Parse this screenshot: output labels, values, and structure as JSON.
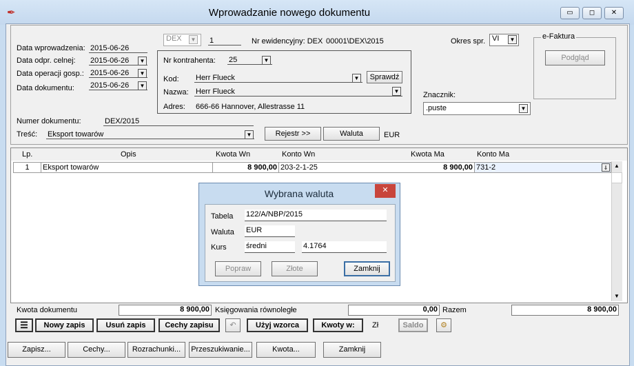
{
  "window": {
    "title": "Wprowadzanie nowego dokumentu",
    "minimize": "▭",
    "restore": "◻",
    "close": "✕"
  },
  "header": {
    "data_wprowadzenia_label": "Data wprowadzenia:",
    "data_wprowadzenia": "2015-06-26",
    "data_odpr_label": "Data odpr. celnej:",
    "data_odpr": "2015-06-26",
    "data_operacji_label": "Data operacji gosp.:",
    "data_operacji": "2015-06-26",
    "data_dokumentu_label": "Data dokumentu:",
    "data_dokumentu": "2015-06-26",
    "doc_type": "DEX",
    "doc_number": "1",
    "nr_ewid_label": "Nr ewidencyjny: DEX",
    "nr_ewid": "00001\\DEX\\2015",
    "okres_label": "Okres spr.",
    "okres": "VI",
    "nr_kontrahenta_label": "Nr kontrahenta:",
    "nr_kontrahenta": "25",
    "kod_label": "Kod:",
    "kod": "Herr Flueck",
    "sprawdz": "Sprawdź",
    "nazwa_label": "Nazwa:",
    "nazwa": "Herr Flueck",
    "adres_label": "Adres:",
    "adres": "666-66 Hannover, Allestrasse 11",
    "efaktura_label": "e-Faktura",
    "podglad": "Podgląd",
    "znacznik_label": "Znacznik:",
    "znacznik": ".puste",
    "numer_dok_label": "Numer dokumentu:",
    "numer_dok": "DEX/2015",
    "tresc_label": "Treść:",
    "tresc": "Eksport towarów",
    "rejestr": "Rejestr >>",
    "waluta_btn": "Waluta",
    "waluta": "EUR"
  },
  "grid": {
    "columns": {
      "lp": "Lp.",
      "opis": "Opis",
      "kwota_wn": "Kwota  Wn",
      "konto_wn": "Konto  Wn",
      "kwota_ma": "Kwota Ma",
      "konto_ma": "Konto Ma"
    },
    "rows": [
      {
        "lp": "1",
        "opis": "Eksport towarów",
        "kwota_wn": "8 900,00",
        "konto_wn": "203-2-1-25",
        "kwota_ma": "8 900,00",
        "konto_ma": "731-2"
      }
    ]
  },
  "dialog": {
    "title": "Wybrana waluta",
    "close": "✕",
    "tabela_label": "Tabela",
    "tabela": "122/A/NBP/2015",
    "waluta_label": "Waluta",
    "waluta": "EUR",
    "kurs_label": "Kurs",
    "kurs_type": "średni",
    "kurs": "4.1764",
    "popraw": "Popraw",
    "zlote": "Złote",
    "zamknij": "Zamknij"
  },
  "footer": {
    "kwota_dok_label": "Kwota dokumentu",
    "kwota_dok": "8 900,00",
    "ksieg_label": "Księgowania równoległe",
    "ksieg": "0,00",
    "razem_label": "Razem",
    "razem": "8 900,00"
  },
  "toolbar": {
    "nowy": "Nowy zapis",
    "usun": "Usuń zapis",
    "cechy_zapisu": "Cechy zapisu",
    "uzyj": "Użyj wzorca",
    "kwoty": "Kwoty w:",
    "zl": "Zł",
    "saldo": "Saldo"
  },
  "bottom": {
    "zapisz": "Zapisz...",
    "cechy": "Cechy...",
    "rozrachunki": "Rozrachunki...",
    "przeszukiwanie": "Przeszukiwanie...",
    "kwota": "Kwota...",
    "zamknij": "Zamknij"
  }
}
